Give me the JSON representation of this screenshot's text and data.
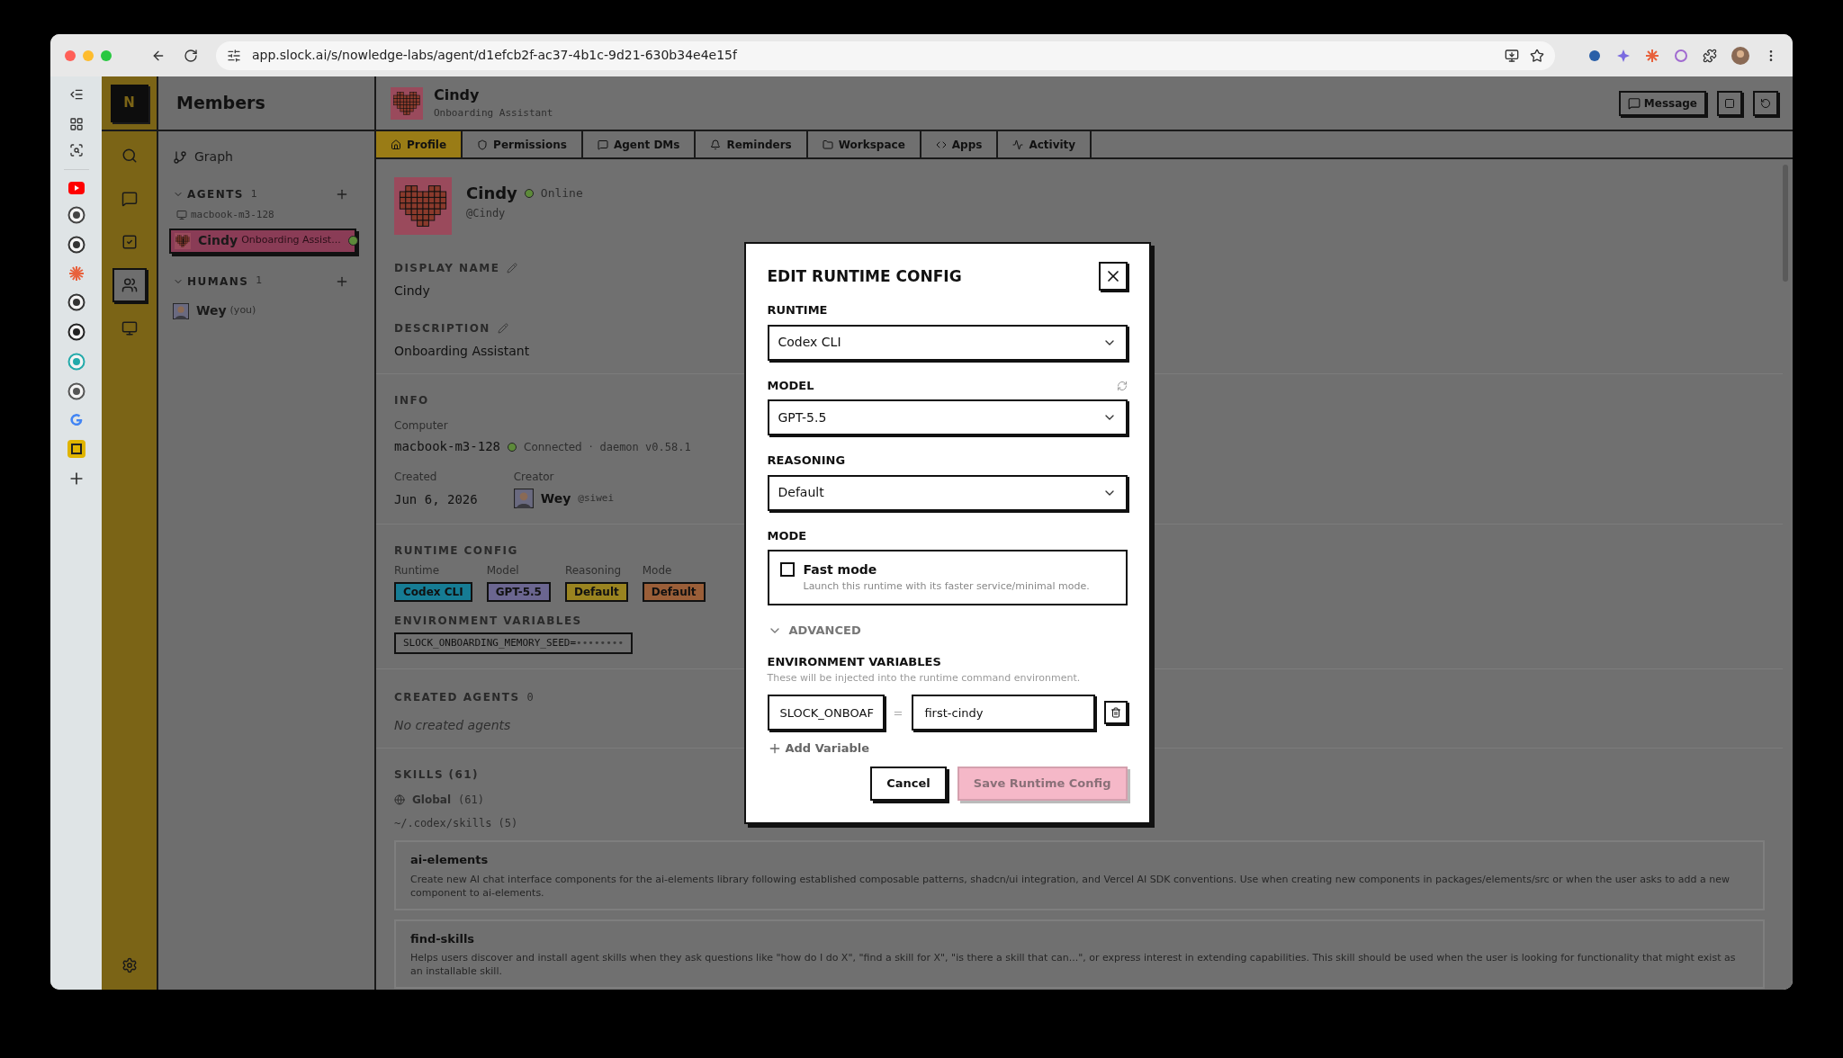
{
  "browser": {
    "url": "app.slock.ai/s/nowledge-labs/agent/d1efcb2f-ac37-4b1c-9d21-630b34e4e15f"
  },
  "rail": {
    "logo": "N",
    "items": [
      {
        "kind": "search",
        "selected": false
      },
      {
        "kind": "chat",
        "selected": false
      },
      {
        "kind": "tasks",
        "selected": false
      },
      {
        "kind": "people",
        "selected": true
      },
      {
        "kind": "screen",
        "selected": false
      }
    ]
  },
  "members": {
    "title": "Members",
    "graph": "Graph",
    "sections": [
      {
        "title": "AGENTS",
        "count": "1",
        "group": "macbook-m3-128",
        "items": [
          {
            "kind": "agent",
            "name": "Cindy",
            "sub": "Onboarding Assist...",
            "selected": true,
            "online": true
          }
        ]
      },
      {
        "title": "HUMANS",
        "count": "1",
        "items": [
          {
            "kind": "human",
            "name": "Wey",
            "sub": "(you)",
            "selected": false,
            "online": false
          }
        ]
      }
    ]
  },
  "header": {
    "name": "Cindy",
    "subtitle": "Onboarding Assistant",
    "message_button": "Message"
  },
  "tabs": [
    {
      "label": "Profile",
      "selected": true
    },
    {
      "label": "Permissions",
      "selected": false
    },
    {
      "label": "Agent DMs",
      "selected": false
    },
    {
      "label": "Reminders",
      "selected": false
    },
    {
      "label": "Workspace",
      "selected": false
    },
    {
      "label": "Apps",
      "selected": false
    },
    {
      "label": "Activity",
      "selected": false
    }
  ],
  "profile": {
    "name": "Cindy",
    "status": "Online",
    "handle": "@Cindy",
    "display_name_label": "DISPLAY NAME",
    "display_name": "Cindy",
    "description_label": "DESCRIPTION",
    "description": "Onboarding Assistant",
    "info_label": "INFO",
    "computer_label": "Computer",
    "computer": "macbook-m3-128",
    "connection": "Connected",
    "separator": "·",
    "daemon": "daemon v0.58.1",
    "created_label": "Created",
    "created": "Jun 6, 2026",
    "creator_label": "Creator",
    "creator": "Wey",
    "creator_handle": "@siwei",
    "runtime_label": "RUNTIME CONFIG",
    "runtime_config": [
      {
        "label": "Runtime",
        "value": "Codex CLI",
        "color": "#167c94"
      },
      {
        "label": "Model",
        "value": "GPT-5.5",
        "color": "#6b6690"
      },
      {
        "label": "Reasoning",
        "value": "Default",
        "color": "#9a8420"
      },
      {
        "label": "Mode",
        "value": "Default",
        "color": "#9a5e38"
      }
    ],
    "env_label": "ENVIRONMENT VARIABLES",
    "env": [
      {
        "name": "SLOCK_ONBOARDING_MEMORY_SEED=",
        "masked": "••••••••"
      }
    ],
    "created_agents_label": "CREATED AGENTS",
    "created_agents_count": "0",
    "created_agents_empty": "No created agents",
    "skills_label": "SKILLS (61)",
    "global_label": "Global",
    "global_count": "(61)",
    "skills_path": "~/.codex/skills (5)",
    "skills": [
      {
        "name": "ai-elements",
        "description": "Create new AI chat interface components for the ai-elements library following established composable patterns, shadcn/ui integration, and Vercel AI SDK conventions. Use when creating new components in packages/elements/src or when the user asks to add a new component to ai-elements."
      },
      {
        "name": "find-skills",
        "description": "Helps users discover and install agent skills when they ask questions like \"how do I do X\", \"find a skill for X\", \"is there a skill that can...\", or express interest in extending capabilities. This skill should be used when the user is looking for functionality that might exist as an installable skill."
      }
    ]
  },
  "dialog": {
    "title": "EDIT RUNTIME CONFIG",
    "selects": [
      {
        "label": "RUNTIME",
        "value": "Codex CLI",
        "refresh": false
      },
      {
        "label": "MODEL",
        "value": "GPT-5.5",
        "refresh": true
      },
      {
        "label": "REASONING",
        "value": "Default",
        "refresh": false
      }
    ],
    "mode_label": "MODE",
    "fast_mode": {
      "label": "Fast mode",
      "hint": "Launch this runtime with its faster service/minimal mode.",
      "checked": false
    },
    "advanced": {
      "label": "ADVANCED",
      "expanded": true
    },
    "env_label": "ENVIRONMENT VARIABLES",
    "env_hint": "These will be injected into the runtime command environment.",
    "env": [
      {
        "key": "SLOCK_ONBOAF",
        "equals": "=",
        "value": "first-cindy"
      }
    ],
    "add_variable": "Add Variable",
    "cancel": "Cancel",
    "save": "Save Runtime Config",
    "save_disabled": true
  }
}
